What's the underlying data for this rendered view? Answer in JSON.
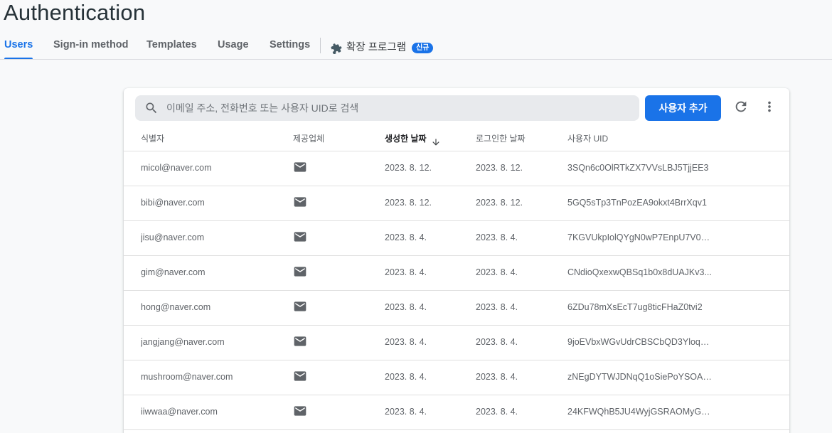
{
  "header": {
    "title": "Authentication",
    "tabs": [
      {
        "label": "Users"
      },
      {
        "label": "Sign-in method"
      },
      {
        "label": "Templates"
      },
      {
        "label": "Usage"
      },
      {
        "label": "Settings"
      },
      {
        "label": "확장 프로그램",
        "badge": "신규"
      }
    ],
    "active_tab": "Users"
  },
  "toolbar": {
    "search_placeholder": "이메일 주소, 전화번호 또는 사용자 UID로 검색",
    "add_user_label": "사용자 추가"
  },
  "table": {
    "columns": [
      "식별자",
      "제공업체",
      "생성한 날짜",
      "로그인한 날짜",
      "사용자 UID"
    ],
    "sorted_column": "생성한 날짜",
    "sort_direction": "descending",
    "rows": [
      {
        "identifier": "micol@naver.com",
        "provider": "mail-icon",
        "created": "2023. 8. 12.",
        "signed_in": "2023. 8. 12.",
        "uid": "3SQn6c0OlRTkZX7VVsLBJ5TjjEE3"
      },
      {
        "identifier": "bibi@naver.com",
        "provider": "mail-icon",
        "created": "2023. 8. 12.",
        "signed_in": "2023. 8. 12.",
        "uid": "5GQ5sTp3TnPozEA9okxt4BrrXqv1"
      },
      {
        "identifier": "jisu@naver.com",
        "provider": "mail-icon",
        "created": "2023. 8. 4.",
        "signed_in": "2023. 8. 4.",
        "uid": "7KGVUkpIolQYgN0wP7EnpU7V08..."
      },
      {
        "identifier": "gim@naver.com",
        "provider": "mail-icon",
        "created": "2023. 8. 4.",
        "signed_in": "2023. 8. 4.",
        "uid": "CNdioQxexwQBSq1b0x8dUAJKv3..."
      },
      {
        "identifier": "hong@naver.com",
        "provider": "mail-icon",
        "created": "2023. 8. 4.",
        "signed_in": "2023. 8. 4.",
        "uid": "6ZDu78mXsEcT7ug8ticFHaZ0tvi2"
      },
      {
        "identifier": "jangjang@naver.com",
        "provider": "mail-icon",
        "created": "2023. 8. 4.",
        "signed_in": "2023. 8. 4.",
        "uid": "9joEVbxWGvUdrCBSCbQD3YloqN..."
      },
      {
        "identifier": "mushroom@naver.com",
        "provider": "mail-icon",
        "created": "2023. 8. 4.",
        "signed_in": "2023. 8. 4.",
        "uid": "zNEgDYTWJDNqQ1oSiePoYSOAx..."
      },
      {
        "identifier": "iiwwaa@naver.com",
        "provider": "mail-icon",
        "created": "2023. 8. 4.",
        "signed_in": "2023. 8. 4.",
        "uid": "24KFWQhB5JU4WyjGSRAOMyGo..."
      }
    ]
  },
  "colors": {
    "accent": "#1a73e8",
    "title": "#263238",
    "page_background": "#f8f9fa",
    "muted_text": "#5f6368"
  }
}
